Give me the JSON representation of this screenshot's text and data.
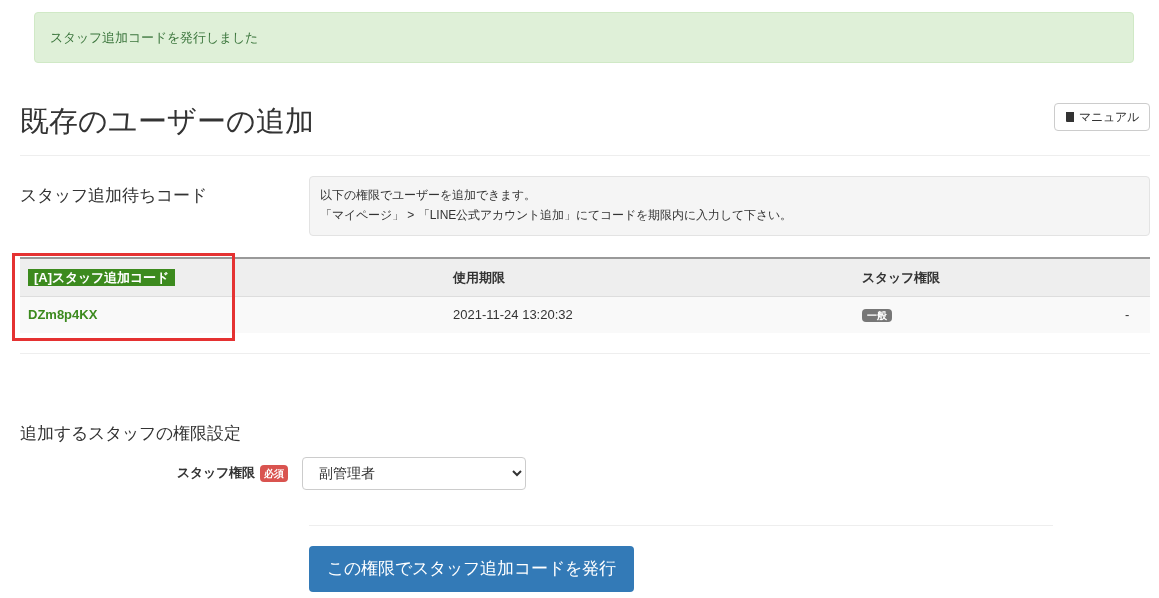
{
  "alert": {
    "message": "スタッフ追加コードを発行しました"
  },
  "page": {
    "title": "既存のユーザーの追加",
    "manual_button": "マニュアル"
  },
  "pending": {
    "label": "スタッフ追加待ちコード",
    "info": [
      "以下の権限でユーザーを追加できます。",
      "「マイページ」 > 「LINE公式アカウント追加」にてコードを期限内に入力して下さい。"
    ]
  },
  "table": {
    "highlight_first_column": true,
    "columns": [
      "[A]スタッフ追加コード",
      "使用期限",
      "スタッフ権限"
    ],
    "rows": [
      {
        "code": "DZm8p4KX",
        "expires": "2021-11-24 13:20:32",
        "role": "一般",
        "column_4": "-"
      }
    ]
  },
  "settings": {
    "title": "追加するスタッフの権限設定",
    "field_label": "スタッフ権限",
    "required_badge": "必須",
    "value": "副管理者",
    "submit": "この権限でスタッフ追加コードを発行"
  }
}
